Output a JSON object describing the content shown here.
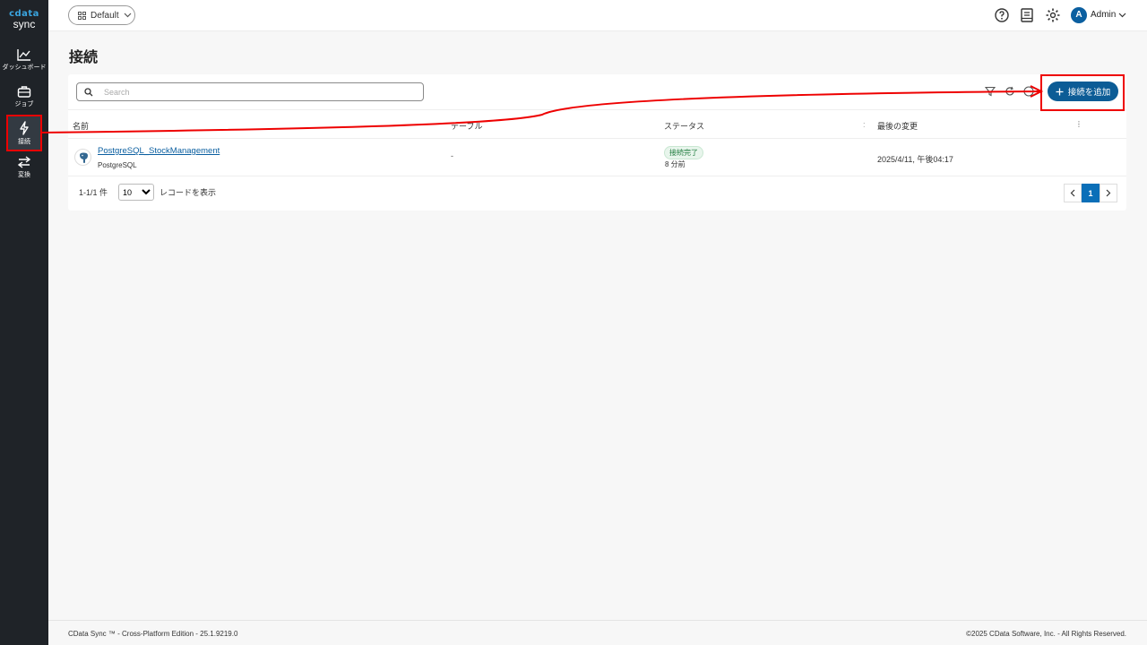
{
  "app": {
    "logo_top": "cdata",
    "logo_bottom": "sync",
    "workspace": "Default",
    "user_initial": "A",
    "user_name": "Admin"
  },
  "sidebar": {
    "items": [
      {
        "label": "ダッシュボード",
        "icon": "chart-line-icon"
      },
      {
        "label": "ジョブ",
        "icon": "briefcase-icon"
      },
      {
        "label": "接続",
        "icon": "lightning-icon",
        "active": true
      },
      {
        "label": "変換",
        "icon": "swap-icon"
      }
    ]
  },
  "page": {
    "title": "接続"
  },
  "toolbar": {
    "search_placeholder": "Search",
    "add_label": "接続を追加"
  },
  "table": {
    "headers": [
      "名前",
      "テーブル",
      "ステータス",
      "最後の変更"
    ],
    "rows": [
      {
        "name": "PostgreSQL_StockManagement",
        "type": "PostgreSQL",
        "table": "-",
        "status": "接続完了",
        "status_time": "8 分前",
        "modified": "2025/4/11, 午後04:17"
      }
    ]
  },
  "pagination": {
    "summary": "1-1/1 件",
    "page_size": "10",
    "page_size_label": "レコードを表示",
    "current_page": "1"
  },
  "footer": {
    "left": "CData Sync ™ - Cross-Platform Edition - 25.1.9219.0",
    "right": "©2025 CData Software, Inc. - All Rights Reserved."
  },
  "colors": {
    "sidebar_bg": "#1f2328",
    "accent": "#0c5c96",
    "annotation": "#e00000",
    "status_ok": "#1e7b3d"
  }
}
